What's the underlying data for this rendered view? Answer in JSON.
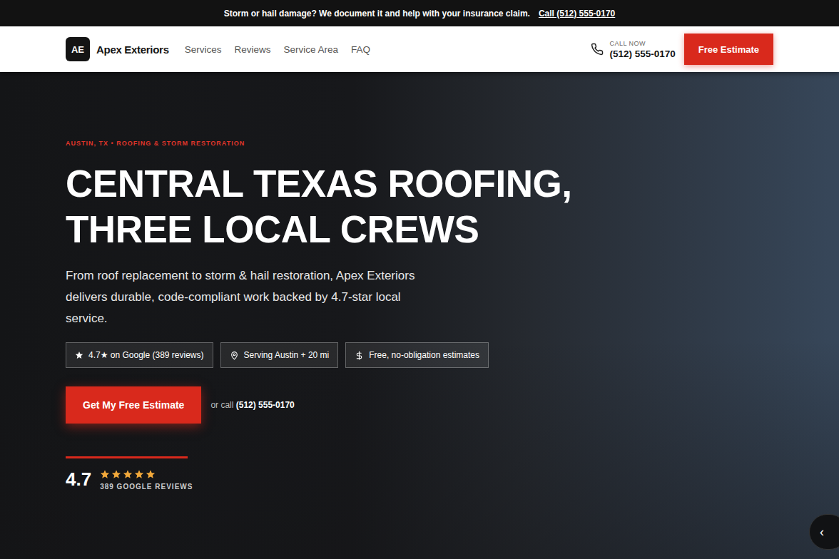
{
  "banner": {
    "text": "Storm or hail damage? We document it and help with your insurance claim.",
    "link": "Call (512) 555-0170"
  },
  "header": {
    "logo_mark": "AE",
    "brand": "Apex Exteriors",
    "nav": [
      "Services",
      "Reviews",
      "Service Area",
      "FAQ"
    ],
    "call_label": "CALL NOW",
    "phone": "(512) 555-0170",
    "cta": "Free Estimate"
  },
  "hero": {
    "eyebrow": "AUSTIN, TX • ROOFING & STORM RESTORATION",
    "title": "CENTRAL TEXAS ROOFING, THREE LOCAL CREWS",
    "subtitle": "From roof replacement to storm & hail restoration, Apex Exteriors delivers durable, code-compliant work backed by 4.7-star local service.",
    "badges": [
      {
        "kind": "rating",
        "label": "4.7★ on Google (389 reviews)"
      },
      {
        "kind": "location",
        "label": "Serving Austin + 20 mi"
      },
      {
        "kind": "price",
        "label": "Free, no-obligation estimates"
      }
    ],
    "cta": "Get My Free Estimate",
    "or_call": "or call",
    "phone": "(512) 555-0170",
    "rating": {
      "score": "4.7",
      "stars": 5,
      "label": "389 GOOGLE REVIEWS"
    },
    "carousel_button": "‹"
  }
}
